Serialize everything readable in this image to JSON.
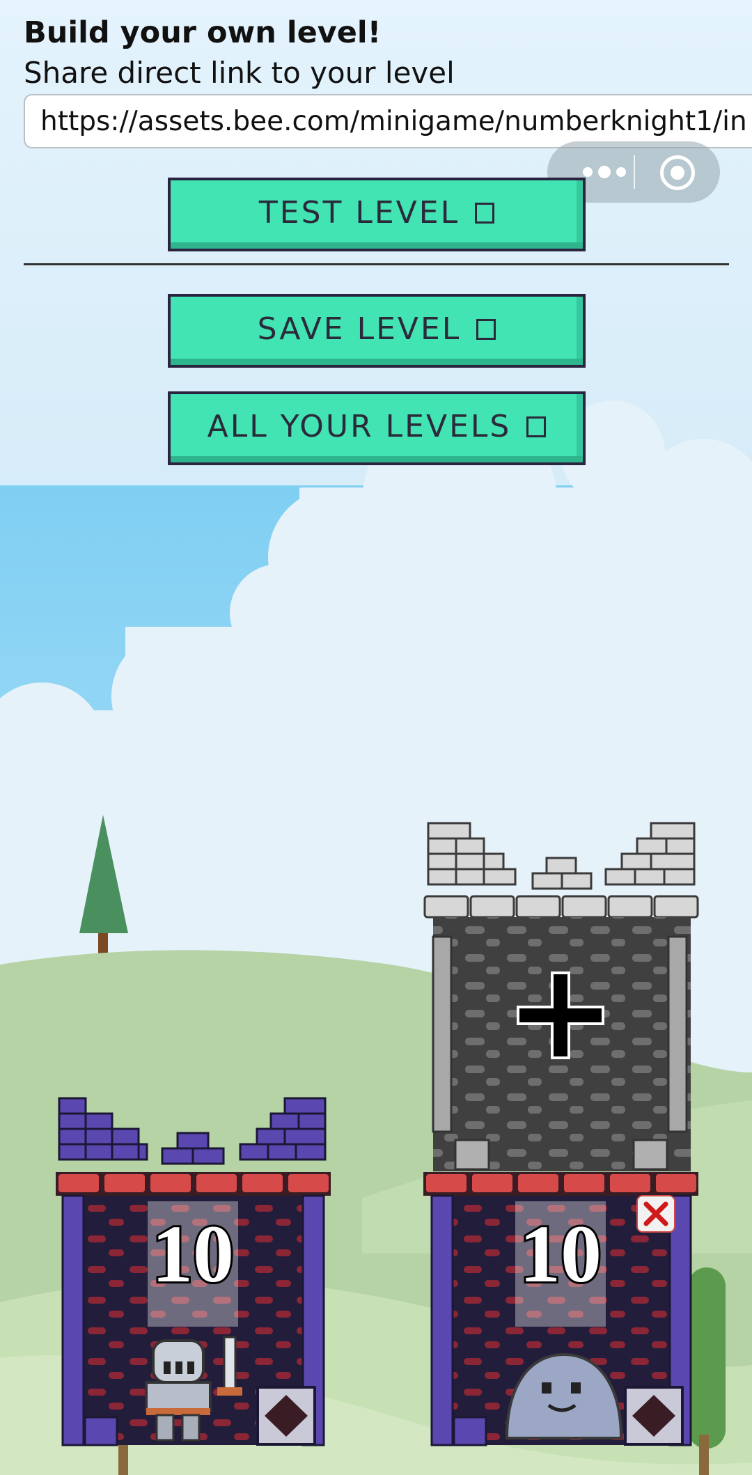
{
  "header": {
    "title": "Build your own level!",
    "subtitle": "Share direct link to your level",
    "link_value": "https://assets.bee.com/minigame/numberknight1/in"
  },
  "buttons": {
    "test": "TEST LEVEL",
    "save": "SAVE LEVEL",
    "all": "ALL YOUR LEVELS"
  },
  "game": {
    "left_tower": {
      "power": "10",
      "occupant": "knight"
    },
    "right_tower": {
      "power": "10",
      "occupant": "slime",
      "add_floor": "+"
    }
  },
  "colors": {
    "button_face": "#43e4b4",
    "button_border": "#2b2440",
    "tower_wall": "#221d3a",
    "tower_trim": "#5a48b0",
    "brick_red": "#d64a4a",
    "stone_grey": "#c8c8c8"
  },
  "icons": [
    "more-dots-icon",
    "close-target-icon",
    "plus-icon",
    "remove-x-icon",
    "diamond-icon"
  ]
}
